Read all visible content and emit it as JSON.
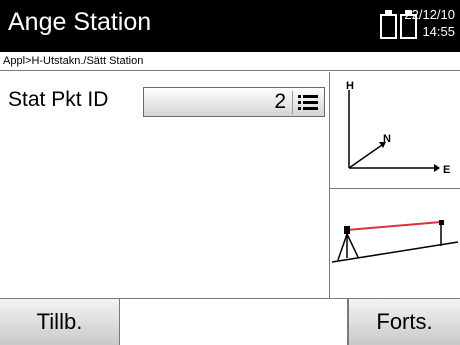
{
  "header": {
    "title": "Ange Station",
    "date": "22/12/10",
    "time": "14:55",
    "battery_icons": [
      "battery-icon",
      "battery-icon"
    ]
  },
  "breadcrumb": "Appl>H-Utstakn./Sätt Station",
  "field": {
    "label": "Stat Pkt ID",
    "value": "2",
    "list_icon": "list-icon"
  },
  "diagram": {
    "axis_h": "H",
    "axis_n": "N",
    "axis_e": "E"
  },
  "softkeys": {
    "left": "Tillb.",
    "middle": "",
    "right": "Forts."
  },
  "colors": {
    "titlebar": "#000000",
    "sightline": "#e0303a",
    "softkey": "#d4d4d4"
  }
}
